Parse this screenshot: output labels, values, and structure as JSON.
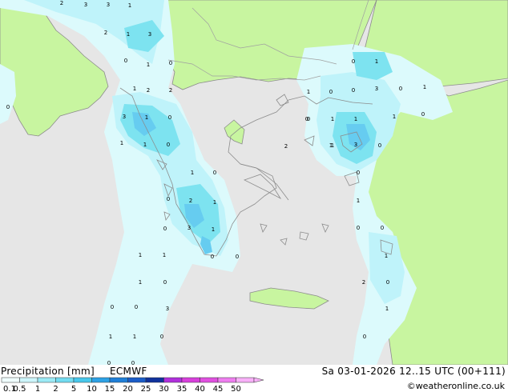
{
  "map": {
    "palette": {
      "sea": "#e6e6e6",
      "land_in_domain": "#e6e6e6",
      "land_outside": "#c8f5a0",
      "coastline": "#888888",
      "border": "#9a9a9a",
      "precip_light": "#dcfafc",
      "precip_mid": "#bff3fa",
      "precip_high": "#7de3f0",
      "precip_peak": "#66ccf0"
    },
    "point_values": [
      "2",
      "3",
      "3",
      "1",
      "2",
      "1",
      "3",
      "0",
      "1",
      "0",
      "0",
      "1",
      "2",
      "2",
      "3",
      "1",
      "0",
      "1",
      "1",
      "0",
      "1",
      "0",
      "2",
      "1",
      "0",
      "3",
      "1",
      "0",
      "0",
      "0",
      "1",
      "1",
      "0",
      "0",
      "1",
      "0",
      "0",
      "1",
      "0",
      "2",
      "0",
      "1",
      "0",
      "3",
      "0",
      "1",
      "1",
      "1",
      "0",
      "0",
      "1",
      "0",
      "0",
      "3",
      "1",
      "0",
      "2",
      "1",
      "0",
      "1",
      "1",
      "0",
      "0",
      "0",
      "3",
      "1",
      "0",
      "1",
      "0",
      "1"
    ]
  },
  "footer": {
    "title": "Precipitation [mm]",
    "model": "ECMWF",
    "valid": "Sa 03-01-2026 12..15 UTC (00+111)",
    "credit": "©weatheronline.co.uk"
  },
  "legend": {
    "ticks": [
      "0.1",
      "0.5",
      "1",
      "2",
      "5",
      "10",
      "15",
      "20",
      "25",
      "30",
      "35",
      "40",
      "45",
      "50"
    ],
    "colors": [
      "#f0fefe",
      "#cdf6fb",
      "#9cebf6",
      "#72dcf1",
      "#48c8ec",
      "#2da2e6",
      "#1f7fd8",
      "#1b5cc8",
      "#10329c",
      "#b030dc",
      "#d840dc",
      "#e050e0",
      "#ef7ef0",
      "#f8b0f8"
    ]
  }
}
